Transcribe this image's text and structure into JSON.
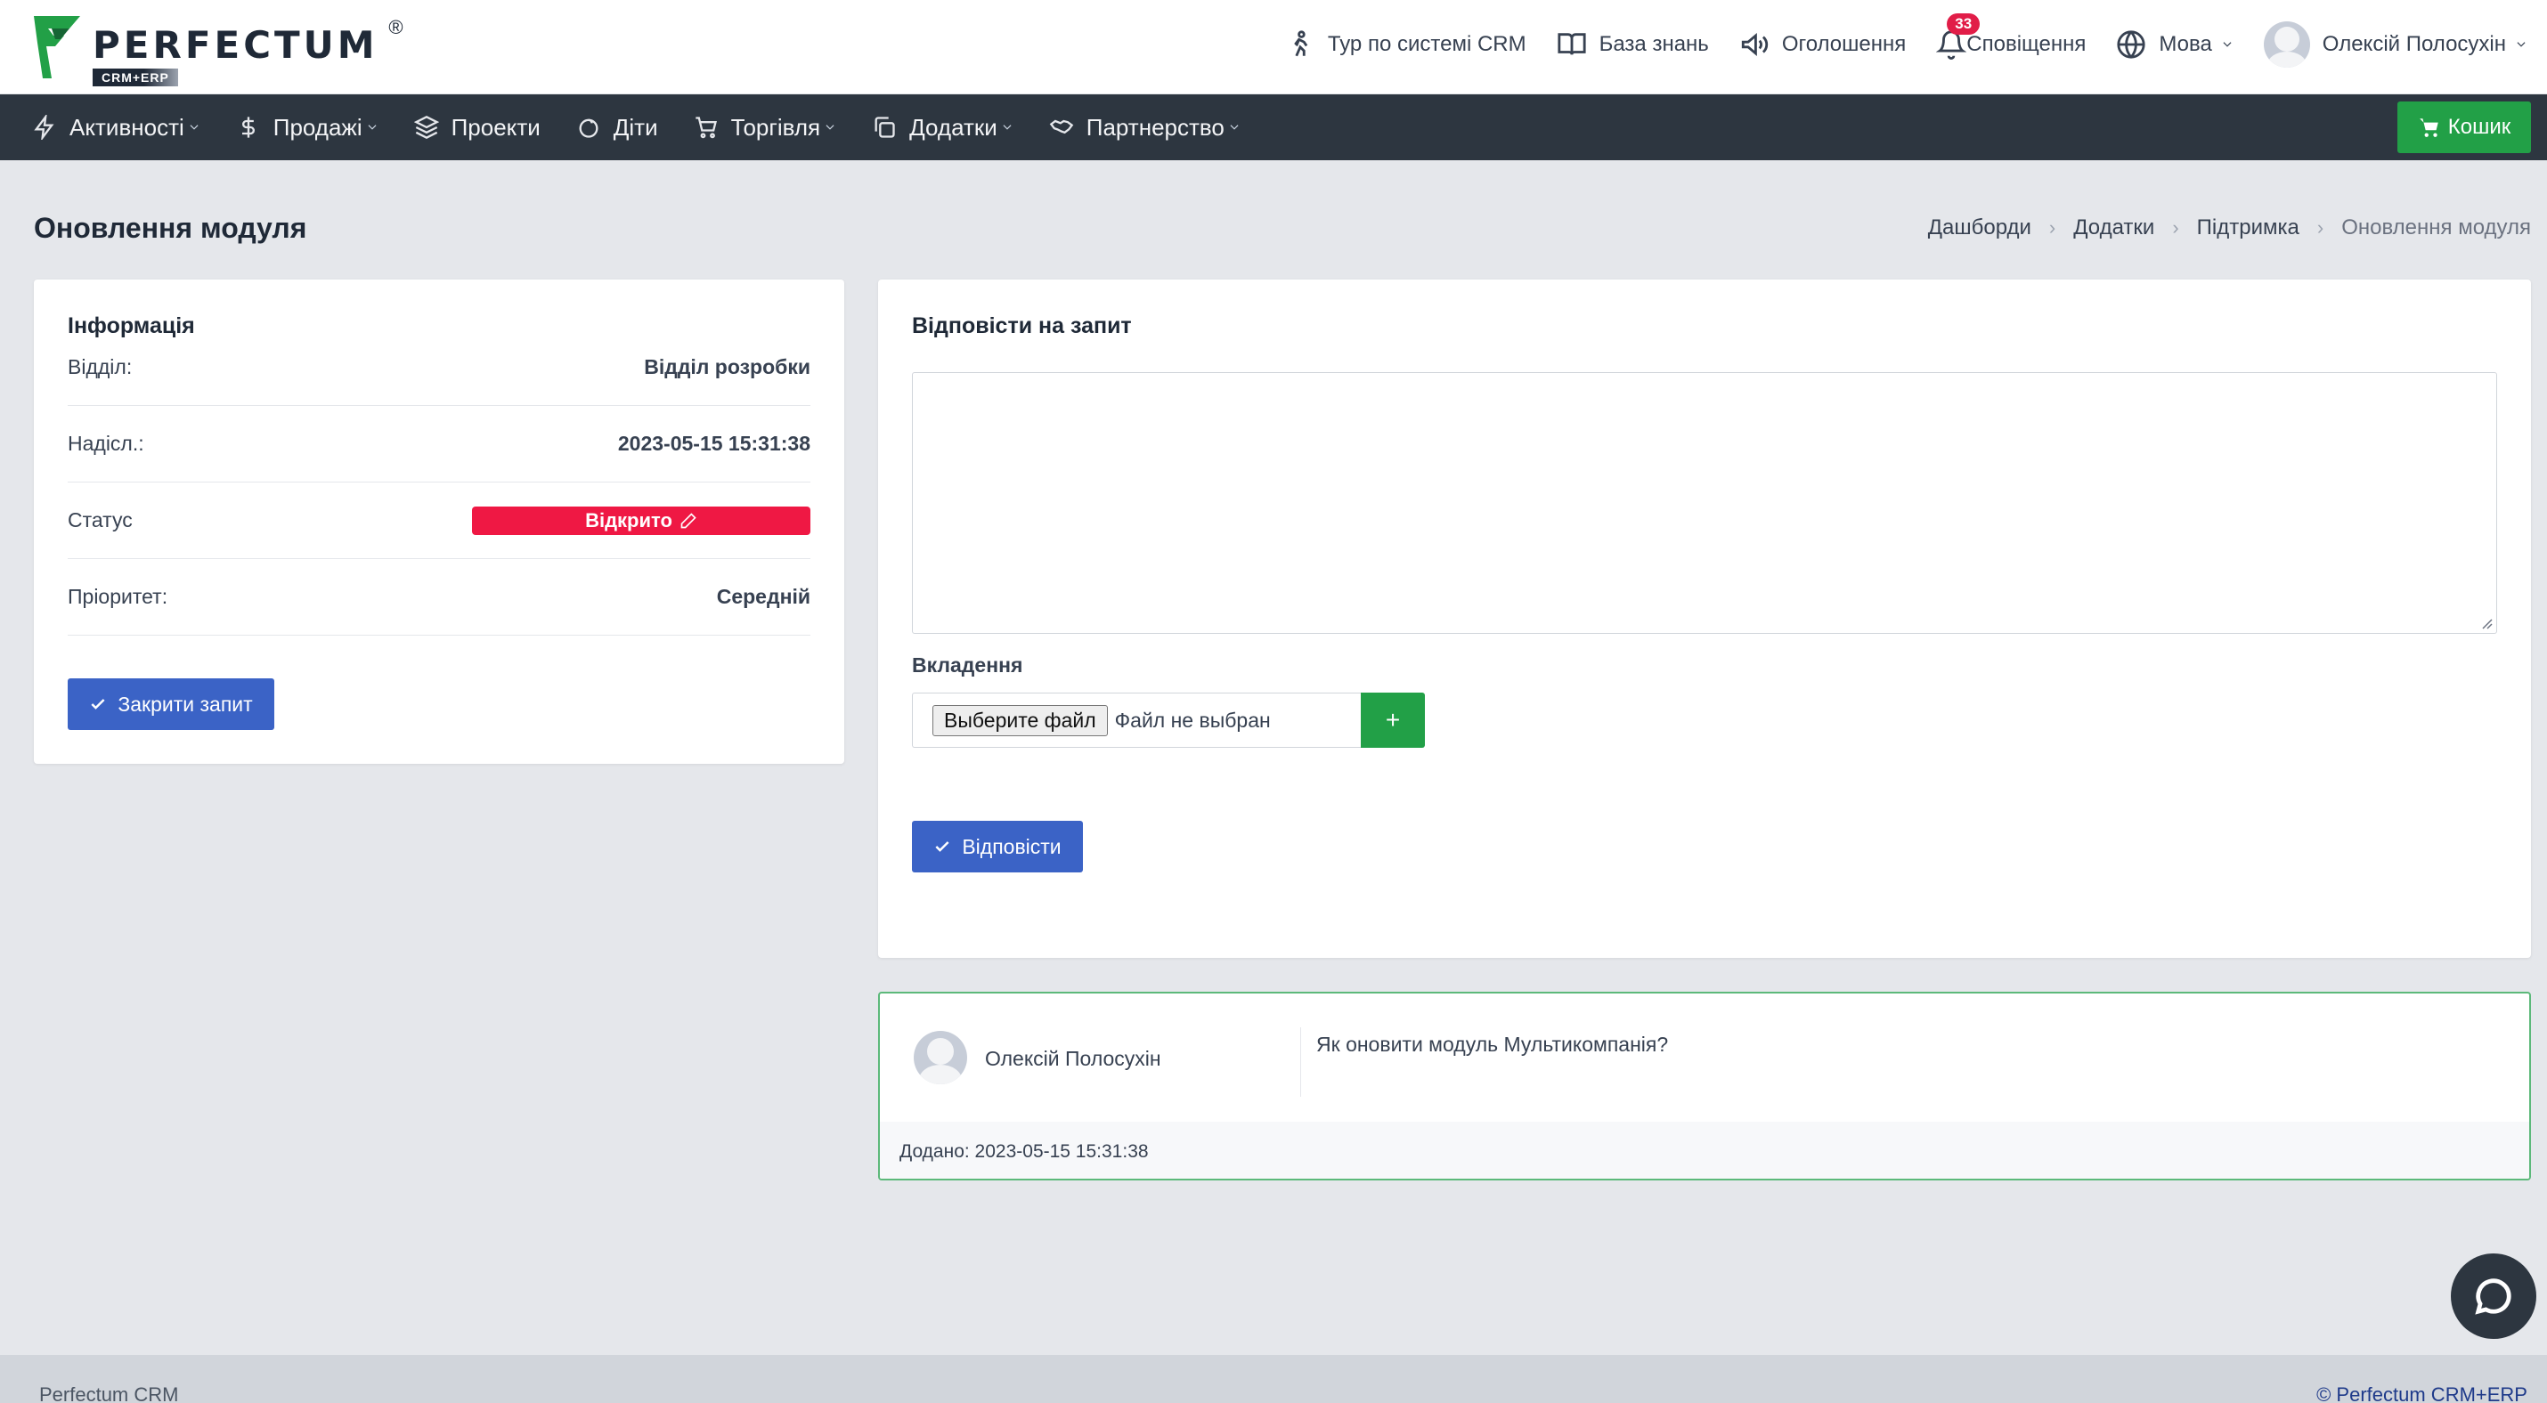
{
  "header": {
    "logo_word": "PERFECTUM",
    "logo_reg": "®",
    "logo_sub": "CRM+ERP",
    "tour": "Тур по системі CRM",
    "knowledge": "База знань",
    "announcements": "Оголошення",
    "notifications": "Сповіщення",
    "notifications_count": "33",
    "language": "Мова",
    "user_name": "Олексій Полосухін"
  },
  "nav": {
    "items": [
      {
        "label": "Активності",
        "icon": "lightning-icon"
      },
      {
        "label": "Продажі",
        "icon": "dollar-icon"
      },
      {
        "label": "Проекти",
        "icon": "layers-icon"
      },
      {
        "label": "Діти",
        "icon": "baby-icon"
      },
      {
        "label": "Торгівля",
        "icon": "cart-icon"
      },
      {
        "label": "Додатки",
        "icon": "copy-icon"
      },
      {
        "label": "Партнерство",
        "icon": "handshake-icon"
      }
    ],
    "cart_label": "Кошик"
  },
  "page": {
    "title": "Оновлення модуля",
    "breadcrumb": [
      "Дашборди",
      "Додатки",
      "Підтримка",
      "Оновлення модуля"
    ]
  },
  "info": {
    "title": "Інформація",
    "department_label": "Відділ:",
    "department_value": "Відділ розробки",
    "sent_label": "Надісл.:",
    "sent_value": "2023-05-15 15:31:38",
    "status_label": "Статус",
    "status_value": "Відкрито",
    "priority_label": "Пріоритет:",
    "priority_value": "Середній",
    "close_button": "Закрити запит",
    "status_color": "#ef1844"
  },
  "reply": {
    "title": "Відповісти на запит",
    "textarea_value": "",
    "attachments_label": "Вкладення",
    "file_button": "Выберите файл",
    "file_status": "Файл не выбран",
    "add_button": "+",
    "submit_button": "Відповісти"
  },
  "entry": {
    "author": "Олексій Полосухін",
    "message": "Як оновити модуль Мультикомпанія?",
    "added": "Додано: 2023-05-15 15:31:38"
  },
  "footer": {
    "left": "Perfectum CRM",
    "right": "© Perfectum CRM+ERP"
  },
  "colors": {
    "nav_bg": "#2d3640",
    "green": "#22a047",
    "blue": "#3b63c6",
    "badge_red": "#e11d48"
  }
}
